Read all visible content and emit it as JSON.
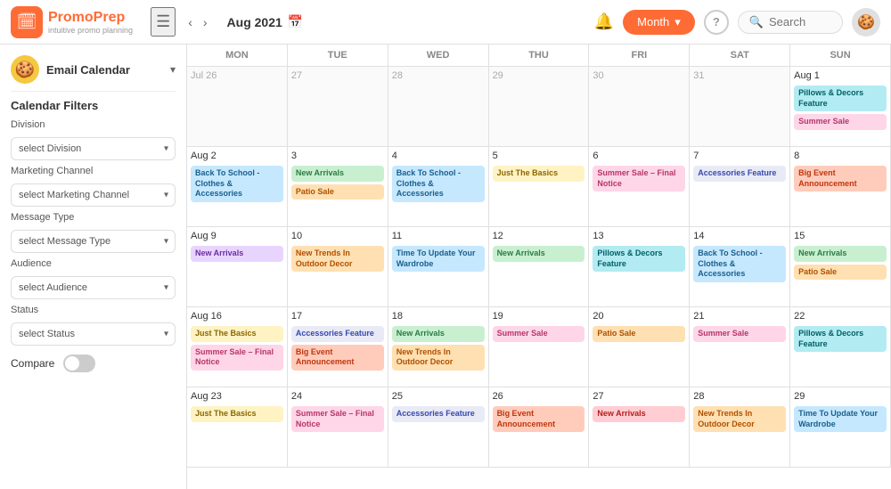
{
  "header": {
    "logo_name": "PromoPrep",
    "logo_tagline": "intuitive promo planning",
    "logo_icon": "🗓",
    "menu_icon": "☰",
    "nav_prev": "‹",
    "nav_next": "›",
    "date": "Aug 2021",
    "calendar_icon": "📅",
    "month_label": "Month",
    "month_dropdown": "▾",
    "help_label": "?",
    "search_placeholder": "Search",
    "search_icon": "🔍",
    "bell_icon": "🔔",
    "profile_icon": "🍪"
  },
  "sidebar": {
    "calendar_type": "Email Calendar",
    "chevron": "▾",
    "filters_title": "Calendar Filters",
    "division_label": "Division",
    "division_placeholder": "select Division",
    "marketing_label": "Marketing Channel",
    "marketing_placeholder": "select Marketing Channel",
    "message_label": "Message Type",
    "message_placeholder": "select Message Type",
    "audience_label": "Audience",
    "audience_placeholder": "select Audience",
    "status_label": "Status",
    "status_placeholder": "select Status",
    "compare_label": "Compare"
  },
  "calendar": {
    "days": [
      "Mon",
      "Tue",
      "Wed",
      "Thu",
      "Fri",
      "Sat",
      "Sun"
    ],
    "weeks": [
      {
        "cells": [
          {
            "date": "Jul 26",
            "other": true,
            "events": []
          },
          {
            "date": "27",
            "other": true,
            "events": []
          },
          {
            "date": "28",
            "other": true,
            "events": []
          },
          {
            "date": "29",
            "other": true,
            "events": []
          },
          {
            "date": "30",
            "other": true,
            "events": []
          },
          {
            "date": "31",
            "other": true,
            "events": []
          },
          {
            "date": "Aug 1",
            "other": false,
            "events": [
              {
                "label": "Pillows & Decors Feature",
                "color": "teal"
              },
              {
                "label": "Summer Sale",
                "color": "pink"
              }
            ]
          }
        ]
      },
      {
        "cells": [
          {
            "date": "Aug 2",
            "other": false,
            "events": [
              {
                "label": "Back To School - Clothes & Accessories",
                "color": "blue"
              }
            ]
          },
          {
            "date": "3",
            "other": false,
            "events": [
              {
                "label": "New Arrivals",
                "color": "green"
              },
              {
                "label": "Patio Sale",
                "color": "orange"
              }
            ]
          },
          {
            "date": "4",
            "other": false,
            "events": [
              {
                "label": "Back To School - Clothes & Accessories",
                "color": "blue"
              }
            ]
          },
          {
            "date": "5",
            "other": false,
            "events": [
              {
                "label": "Just The Basics",
                "color": "yellow"
              }
            ]
          },
          {
            "date": "6",
            "other": false,
            "events": [
              {
                "label": "Summer Sale – Final Notice",
                "color": "pink"
              }
            ]
          },
          {
            "date": "7",
            "other": false,
            "events": [
              {
                "label": "Accessories Feature",
                "color": "lavender"
              }
            ]
          },
          {
            "date": "8",
            "other": false,
            "events": [
              {
                "label": "Big Event Announcement",
                "color": "salmon"
              }
            ]
          }
        ]
      },
      {
        "cells": [
          {
            "date": "Aug 9",
            "other": false,
            "events": [
              {
                "label": "New Arrivals",
                "color": "purple"
              }
            ]
          },
          {
            "date": "10",
            "other": false,
            "events": [
              {
                "label": "New Trends In Outdoor Decor",
                "color": "orange"
              }
            ]
          },
          {
            "date": "11",
            "other": false,
            "events": [
              {
                "label": "Time To Update Your Wardrobe",
                "color": "blue"
              }
            ]
          },
          {
            "date": "12",
            "other": false,
            "events": [
              {
                "label": "New Arrivals",
                "color": "green"
              }
            ]
          },
          {
            "date": "13",
            "other": false,
            "events": [
              {
                "label": "Pillows & Decors Feature",
                "color": "teal"
              }
            ]
          },
          {
            "date": "14",
            "other": false,
            "events": [
              {
                "label": "Back To School - Clothes & Accessories",
                "color": "blue"
              }
            ]
          },
          {
            "date": "15",
            "other": false,
            "events": [
              {
                "label": "New Arrivals",
                "color": "green"
              },
              {
                "label": "Patio Sale",
                "color": "orange"
              }
            ]
          }
        ]
      },
      {
        "cells": [
          {
            "date": "Aug 16",
            "other": false,
            "events": [
              {
                "label": "Just The Basics",
                "color": "yellow"
              },
              {
                "label": "Summer Sale – Final Notice",
                "color": "pink"
              }
            ]
          },
          {
            "date": "17",
            "other": false,
            "events": [
              {
                "label": "Accessories Feature",
                "color": "lavender"
              },
              {
                "label": "Big Event Announcement",
                "color": "salmon"
              }
            ]
          },
          {
            "date": "18",
            "other": false,
            "events": [
              {
                "label": "New Arrivals",
                "color": "green"
              },
              {
                "label": "New Trends In Outdoor Decor",
                "color": "orange"
              }
            ]
          },
          {
            "date": "19",
            "other": false,
            "events": [
              {
                "label": "Summer Sale",
                "color": "pink"
              }
            ]
          },
          {
            "date": "20",
            "other": false,
            "events": [
              {
                "label": "Patio Sale",
                "color": "orange"
              }
            ]
          },
          {
            "date": "21",
            "other": false,
            "events": [
              {
                "label": "Summer Sale",
                "color": "pink"
              }
            ]
          },
          {
            "date": "22",
            "other": false,
            "events": [
              {
                "label": "Pillows & Decors Feature",
                "color": "teal"
              }
            ]
          }
        ]
      },
      {
        "cells": [
          {
            "date": "Aug 23",
            "other": false,
            "events": [
              {
                "label": "Just The Basics",
                "color": "yellow"
              }
            ]
          },
          {
            "date": "24",
            "other": false,
            "events": [
              {
                "label": "Summer Sale – Final Notice",
                "color": "pink"
              }
            ]
          },
          {
            "date": "25",
            "other": false,
            "events": [
              {
                "label": "Accessories Feature",
                "color": "lavender"
              }
            ]
          },
          {
            "date": "26",
            "other": false,
            "events": [
              {
                "label": "Big Event Announcement",
                "color": "salmon"
              }
            ]
          },
          {
            "date": "27",
            "other": false,
            "events": [
              {
                "label": "New Arrivals",
                "color": "red"
              }
            ]
          },
          {
            "date": "28",
            "other": false,
            "events": [
              {
                "label": "New Trends In Outdoor Decor",
                "color": "orange"
              }
            ]
          },
          {
            "date": "29",
            "other": false,
            "events": [
              {
                "label": "Time To Update Your Wardrobe",
                "color": "blue"
              }
            ]
          }
        ]
      }
    ]
  }
}
